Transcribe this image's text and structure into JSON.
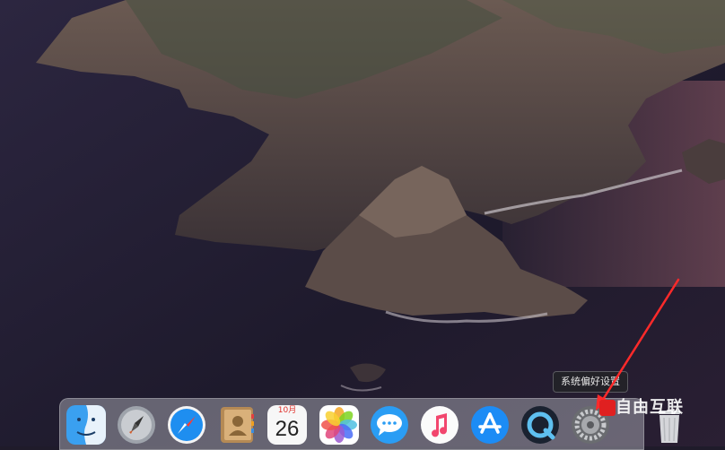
{
  "desktop": {
    "wallpaper": "catalina-island-cliffs"
  },
  "dock": {
    "items": [
      {
        "name": "Finder",
        "icon": "finder-icon"
      },
      {
        "name": "Launchpad",
        "icon": "rocket-icon"
      },
      {
        "name": "Safari",
        "icon": "compass-icon"
      },
      {
        "name": "Contacts",
        "icon": "contacts-book-icon"
      },
      {
        "name": "Calendar",
        "icon": "calendar-icon",
        "month": "10月",
        "day": "26"
      },
      {
        "name": "Photos",
        "icon": "photos-flower-icon"
      },
      {
        "name": "Messages",
        "icon": "speech-bubble-icon"
      },
      {
        "name": "Music",
        "icon": "music-note-icon"
      },
      {
        "name": "App Store",
        "icon": "app-store-icon"
      },
      {
        "name": "QuickTime Player",
        "icon": "quicktime-icon"
      },
      {
        "name": "System Preferences",
        "icon": "gear-icon"
      },
      {
        "name": "Trash",
        "icon": "trash-icon"
      }
    ],
    "tooltip": "系统偏好设置"
  },
  "annotation": {
    "arrow_color": "#ff2a2a"
  },
  "watermark": {
    "text": "自由互联"
  }
}
